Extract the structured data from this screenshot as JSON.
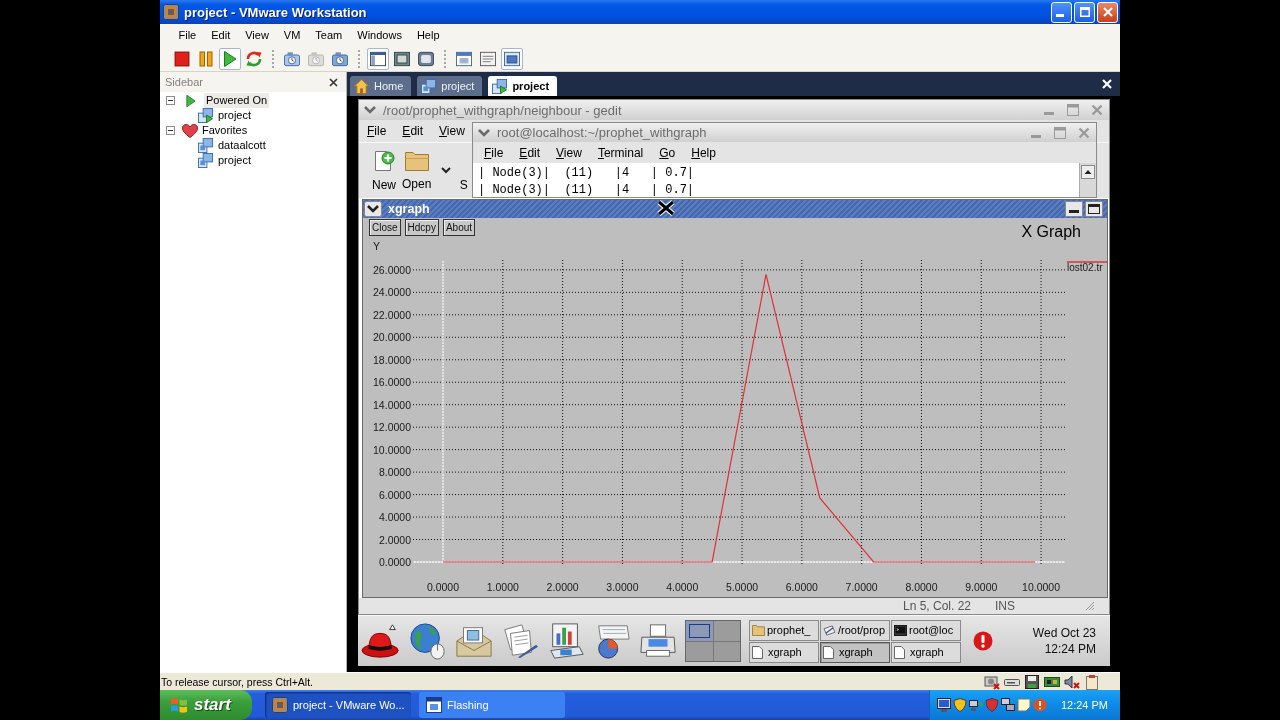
{
  "window": {
    "title": "project - VMware Workstation"
  },
  "menu": [
    "File",
    "Edit",
    "View",
    "VM",
    "Team",
    "Windows",
    "Help"
  ],
  "toolbar": [
    [
      {
        "kind": "stop",
        "pressed": false,
        "disabled": false
      },
      {
        "kind": "pause",
        "pressed": false,
        "disabled": false
      },
      {
        "kind": "play",
        "pressed": true,
        "disabled": false
      },
      {
        "kind": "reset",
        "pressed": false,
        "disabled": false
      }
    ],
    [
      {
        "kind": "snapshot",
        "pressed": false,
        "disabled": false
      },
      {
        "kind": "revert",
        "pressed": false,
        "disabled": true
      },
      {
        "kind": "snapshot-manager",
        "pressed": false,
        "disabled": false
      }
    ],
    [
      {
        "kind": "sidebar",
        "pressed": true,
        "disabled": false
      },
      {
        "kind": "full-screen",
        "pressed": false,
        "disabled": false
      },
      {
        "kind": "quick-switch",
        "pressed": false,
        "disabled": false
      }
    ],
    [
      {
        "kind": "summary",
        "pressed": false,
        "disabled": false
      },
      {
        "kind": "console",
        "pressed": false,
        "disabled": false
      },
      {
        "kind": "tabs",
        "pressed": true,
        "disabled": false
      }
    ]
  ],
  "sidebar": {
    "title": "Sidebar",
    "tree": [
      {
        "label": "Powered On",
        "kind": "powered",
        "expanded": true,
        "selected": true,
        "children": [
          {
            "label": "project",
            "kind": "vm-on",
            "selected": false
          }
        ]
      },
      {
        "label": "Favorites",
        "kind": "favorites",
        "expanded": true,
        "selected": false,
        "children": [
          {
            "label": "dataalcott",
            "kind": "vm",
            "selected": false
          },
          {
            "label": "project",
            "kind": "vm",
            "selected": false
          }
        ]
      }
    ]
  },
  "tabs": [
    {
      "label": "Home",
      "kind": "home",
      "selected": false
    },
    {
      "label": "project",
      "kind": "vm",
      "selected": false
    },
    {
      "label": "project",
      "kind": "vm-on",
      "selected": true
    }
  ],
  "guest": {
    "gedit": {
      "title": "/root/prophet_withgraph/neighbour - gedit",
      "menu": [
        "File",
        "Edit",
        "View"
      ],
      "toolbar": [
        {
          "kind": "new",
          "label": "New"
        },
        {
          "kind": "open",
          "label": "Open"
        },
        {
          "kind": "dropdown"
        },
        {
          "kind": "save",
          "label": "S"
        }
      ],
      "status": [
        "Ln 5, Col. 22",
        "INS"
      ]
    },
    "terminal": {
      "title": "root@localhost:~/prophet_withgraph",
      "menu": [
        "File",
        "Edit",
        "View",
        "Terminal",
        "Go",
        "Help"
      ],
      "lines": [
        "| Node(3)|  (11)   |4   | 0.7|",
        "| Node(3)|  (11)   |4   | 0.7|"
      ]
    },
    "xgraph": {
      "title": "xgraph",
      "buttons": [
        "Close",
        "Hdcpy",
        "About"
      ],
      "chart_data": {
        "type": "line",
        "title": "X Graph",
        "ylabel": "Y",
        "xlim": [
          0,
          10.4
        ],
        "ylim": [
          0,
          26.7
        ],
        "xticks": [
          {
            "value": 0,
            "label": "0.0000"
          },
          {
            "value": 1,
            "label": "1.0000"
          },
          {
            "value": 2,
            "label": "2.0000"
          },
          {
            "value": 3,
            "label": "3.0000"
          },
          {
            "value": 4,
            "label": "4.0000"
          },
          {
            "value": 5,
            "label": "5.0000"
          },
          {
            "value": 6,
            "label": "6.0000"
          },
          {
            "value": 7,
            "label": "7.0000"
          },
          {
            "value": 8,
            "label": "8.0000"
          },
          {
            "value": 9,
            "label": "9.0000"
          },
          {
            "value": 10,
            "label": "10.0000"
          }
        ],
        "yticks": [
          {
            "value": 0,
            "label": "0.0000"
          },
          {
            "value": 2,
            "label": "2.0000"
          },
          {
            "value": 4,
            "label": "4.0000"
          },
          {
            "value": 6,
            "label": "6.0000"
          },
          {
            "value": 8,
            "label": "8.0000"
          },
          {
            "value": 10,
            "label": "10.0000"
          },
          {
            "value": 12,
            "label": "12.0000"
          },
          {
            "value": 14,
            "label": "14.0000"
          },
          {
            "value": 16,
            "label": "16.0000"
          },
          {
            "value": 18,
            "label": "18.0000"
          },
          {
            "value": 20,
            "label": "20.0000"
          },
          {
            "value": 22,
            "label": "22.0000"
          },
          {
            "value": 24,
            "label": "24.0000"
          },
          {
            "value": 26,
            "label": "26.0000"
          }
        ],
        "grid": true,
        "legend": "right",
        "series": [
          {
            "name": "lost02.tr",
            "color": "#e0303a",
            "x": [
              0,
              4.5,
              5.4,
              6.3,
              7.2,
              9.9
            ],
            "values": [
              0,
              0,
              25.6,
              5.7,
              0,
              0
            ]
          }
        ]
      }
    },
    "panel": {
      "workspaces": [
        {
          "selected": true
        },
        {
          "selected": false
        },
        {
          "selected": false
        },
        {
          "selected": false
        }
      ],
      "tasks": [
        {
          "label": "prophet_",
          "kind": "folder",
          "selected": false
        },
        {
          "label": "/root/prop",
          "kind": "editor",
          "selected": false
        },
        {
          "label": "root@loc",
          "kind": "terminal",
          "selected": false
        },
        {
          "label": "xgraph",
          "kind": "window",
          "selected": false
        },
        {
          "label": "xgraph",
          "kind": "window",
          "selected": true
        },
        {
          "label": "xgraph",
          "kind": "window",
          "selected": false
        }
      ],
      "clock": [
        "Wed Oct 23",
        "12:24 PM"
      ]
    }
  },
  "statusbar": {
    "message": "To release cursor, press Ctrl+Alt."
  },
  "taskbar": {
    "start": "start",
    "tasks": [
      {
        "label": "project - VMware Wo...",
        "kind": "vmware",
        "selected": true
      },
      {
        "label": "Flashing",
        "kind": "window",
        "selected": false
      }
    ],
    "clock": "12:24 PM"
  }
}
